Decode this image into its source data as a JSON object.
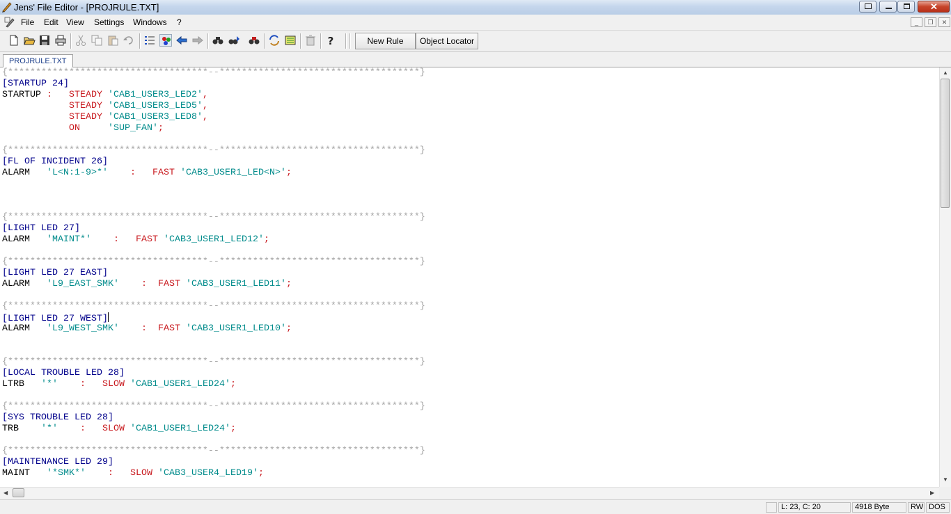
{
  "window": {
    "title": "Jens' File Editor - [PROJRULE.TXT]",
    "controls": [
      "pin",
      "minimize",
      "maximize",
      "close"
    ]
  },
  "menu": {
    "items": [
      "File",
      "Edit",
      "View",
      "Settings",
      "Windows",
      "?"
    ]
  },
  "toolbar": {
    "icons": [
      "new-file-icon",
      "open-folder-icon",
      "save-icon",
      "print-icon",
      "cut-icon",
      "copy-icon",
      "paste-icon",
      "undo-icon",
      "list-icon",
      "color-icon",
      "back-icon",
      "forward-icon",
      "find-icon",
      "find-replace-icon",
      "find-next-icon",
      "refresh-icon",
      "compare-icon",
      "delete-icon",
      "help-icon"
    ],
    "new_rule": "New Rule",
    "object_locator": "Object Locator"
  },
  "tab": {
    "label": "PROJRULE.TXT"
  },
  "editor": {
    "lines": [
      [
        [
          "cm",
          "{************************************--************************************}"
        ]
      ],
      [
        [
          "sec",
          "[STARTUP 24]"
        ]
      ],
      [
        [
          "kw",
          "STARTUP "
        ],
        [
          "op",
          ":   STEADY "
        ],
        [
          "str",
          "'CAB1_USER3_LED2'"
        ],
        [
          "op",
          ","
        ]
      ],
      [
        [
          "op",
          "            STEADY "
        ],
        [
          "str",
          "'CAB1_USER3_LED5'"
        ],
        [
          "op",
          ","
        ]
      ],
      [
        [
          "op",
          "            STEADY "
        ],
        [
          "str",
          "'CAB1_USER3_LED8'"
        ],
        [
          "op",
          ","
        ]
      ],
      [
        [
          "op",
          "            ON     "
        ],
        [
          "str",
          "'SUP_FAN'"
        ],
        [
          "op",
          ";"
        ]
      ],
      [],
      [
        [
          "cm",
          "{************************************--************************************}"
        ]
      ],
      [
        [
          "sec",
          "[FL OF INCIDENT 26]"
        ]
      ],
      [
        [
          "kw",
          "ALARM   "
        ],
        [
          "str",
          "'L<N:1-9>*'"
        ],
        [
          "op",
          "    :   FAST "
        ],
        [
          "str",
          "'CAB3_USER1_LED<N>'"
        ],
        [
          "op",
          ";"
        ]
      ],
      [],
      [],
      [],
      [
        [
          "cm",
          "{************************************--************************************}"
        ]
      ],
      [
        [
          "sec",
          "[LIGHT LED 27]"
        ]
      ],
      [
        [
          "kw",
          "ALARM   "
        ],
        [
          "str",
          "'MAINT*'"
        ],
        [
          "op",
          "    :   FAST "
        ],
        [
          "str",
          "'CAB3_USER1_LED12'"
        ],
        [
          "op",
          ";"
        ]
      ],
      [],
      [
        [
          "cm",
          "{************************************--************************************}"
        ]
      ],
      [
        [
          "sec",
          "[LIGHT LED 27 EAST]"
        ]
      ],
      [
        [
          "kw",
          "ALARM   "
        ],
        [
          "str",
          "'L9_EAST_SMK'"
        ],
        [
          "op",
          "    :  FAST "
        ],
        [
          "str",
          "'CAB3_USER1_LED11'"
        ],
        [
          "op",
          ";"
        ]
      ],
      [],
      [
        [
          "cm",
          "{************************************--************************************}"
        ]
      ],
      [
        [
          "sec",
          "[LIGHT LED 27 WEST]"
        ],
        [
          "cursor",
          ""
        ]
      ],
      [
        [
          "kw",
          "ALARM   "
        ],
        [
          "str",
          "'L9_WEST_SMK'"
        ],
        [
          "op",
          "    :  FAST "
        ],
        [
          "str",
          "'CAB3_USER1_LED10'"
        ],
        [
          "op",
          ";"
        ]
      ],
      [],
      [],
      [
        [
          "cm",
          "{************************************--************************************}"
        ]
      ],
      [
        [
          "sec",
          "[LOCAL TROUBLE LED 28]"
        ]
      ],
      [
        [
          "kw",
          "LTRB   "
        ],
        [
          "str",
          "'*'"
        ],
        [
          "op",
          "    :   SLOW "
        ],
        [
          "str",
          "'CAB1_USER1_LED24'"
        ],
        [
          "op",
          ";"
        ]
      ],
      [],
      [
        [
          "cm",
          "{************************************--************************************}"
        ]
      ],
      [
        [
          "sec",
          "[SYS TROUBLE LED 28]"
        ]
      ],
      [
        [
          "kw",
          "TRB    "
        ],
        [
          "str",
          "'*'"
        ],
        [
          "op",
          "    :   SLOW "
        ],
        [
          "str",
          "'CAB1_USER1_LED24'"
        ],
        [
          "op",
          ";"
        ]
      ],
      [],
      [
        [
          "cm",
          "{************************************--************************************}"
        ]
      ],
      [
        [
          "sec",
          "[MAINTENANCE LED 29]"
        ]
      ],
      [
        [
          "kw",
          "MAINT   "
        ],
        [
          "str",
          "'*SMK*'"
        ],
        [
          "op",
          "    :   SLOW "
        ],
        [
          "str",
          "'CAB3_USER4_LED19'"
        ],
        [
          "op",
          ";"
        ]
      ]
    ]
  },
  "status": {
    "position": "L: 23, C: 20",
    "size": "4918 Byte",
    "mode": "RW",
    "format": "DOS"
  },
  "colors": {
    "comment": "#a3a3a3",
    "section": "#00008b",
    "keyword": "#000000",
    "operator": "#c8191e",
    "string": "#008b8b"
  }
}
